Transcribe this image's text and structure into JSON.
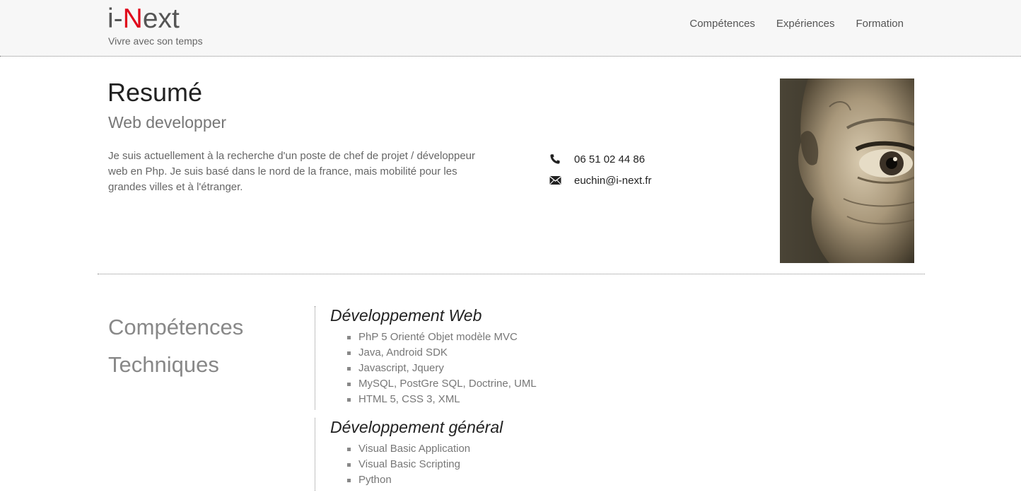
{
  "header": {
    "logo_prefix": "i-",
    "logo_accent": "N",
    "logo_suffix": "ext",
    "tagline": "Vivre avec son temps",
    "nav": [
      "Compétences",
      "Expériences",
      "Formation"
    ],
    "accent_color": "#e0081b"
  },
  "resume": {
    "title": "Resumé",
    "subtitle": "Web developper",
    "text": "Je suis actuellement à la recherche d'un poste de chef de projet / développeur web en Php. Je suis basé dans le nord de la france, mais mobilité pour les grandes villes et à l'étranger.",
    "phone_icon": "phone-icon",
    "phone": "06 51 02 44 86",
    "email_icon": "envelope-icon",
    "email": "euchin@i-next.fr"
  },
  "skills": {
    "heading_line1": "Compétences",
    "heading_line2": "Techniques",
    "blocks": [
      {
        "title": "Développement Web",
        "items": [
          "PhP 5 Orienté Objet modèle MVC",
          "Java, Android SDK",
          "Javascript, Jquery",
          "MySQL, PostGre SQL, Doctrine, UML",
          "HTML 5, CSS 3, XML"
        ]
      },
      {
        "title": "Développement général",
        "items": [
          "Visual Basic Application",
          "Visual Basic Scripting",
          "Python"
        ]
      }
    ]
  }
}
